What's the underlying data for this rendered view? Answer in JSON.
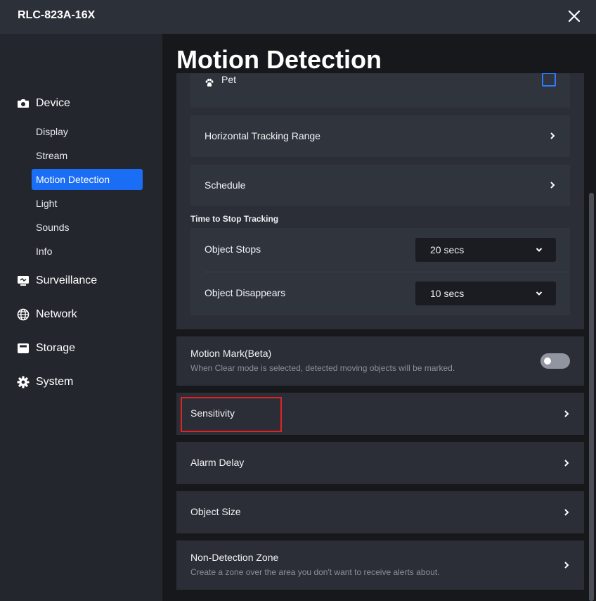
{
  "window": {
    "title": "RLC-823A-16X"
  },
  "sidebar": {
    "device": {
      "label": "Device",
      "items": [
        {
          "label": "Display"
        },
        {
          "label": "Stream"
        },
        {
          "label": "Motion Detection",
          "active": true
        },
        {
          "label": "Light"
        },
        {
          "label": "Sounds"
        },
        {
          "label": "Info"
        }
      ]
    },
    "sections": [
      {
        "label": "Surveillance",
        "icon": "monitor-icon"
      },
      {
        "label": "Network",
        "icon": "globe-icon"
      },
      {
        "label": "Storage",
        "icon": "storage-icon"
      },
      {
        "label": "System",
        "icon": "gear-icon"
      }
    ]
  },
  "main": {
    "title": "Motion Detection",
    "pet": {
      "label": "Pet",
      "checked": false,
      "icon": "paw-icon"
    },
    "horizontal_tracking": {
      "label": "Horizontal Tracking Range"
    },
    "schedule": {
      "label": "Schedule"
    },
    "time_to_stop": {
      "heading": "Time to Stop Tracking",
      "object_stops": {
        "label": "Object Stops",
        "value": "20 secs"
      },
      "object_disappears": {
        "label": "Object Disappears",
        "value": "10 secs"
      }
    },
    "motion_mark": {
      "title": "Motion Mark(Beta)",
      "description": "When Clear mode is selected, detected moving objects will be marked.",
      "enabled": false
    },
    "sensitivity": {
      "label": "Sensitivity"
    },
    "alarm_delay": {
      "label": "Alarm Delay"
    },
    "object_size": {
      "label": "Object Size"
    },
    "non_detection_zone": {
      "title": "Non-Detection Zone",
      "description": "Create a zone over the area you don't want to receive alerts about."
    }
  },
  "colors": {
    "accent": "#1a6ef5",
    "highlight": "#e02424",
    "checkbox": "#2c7bff"
  }
}
